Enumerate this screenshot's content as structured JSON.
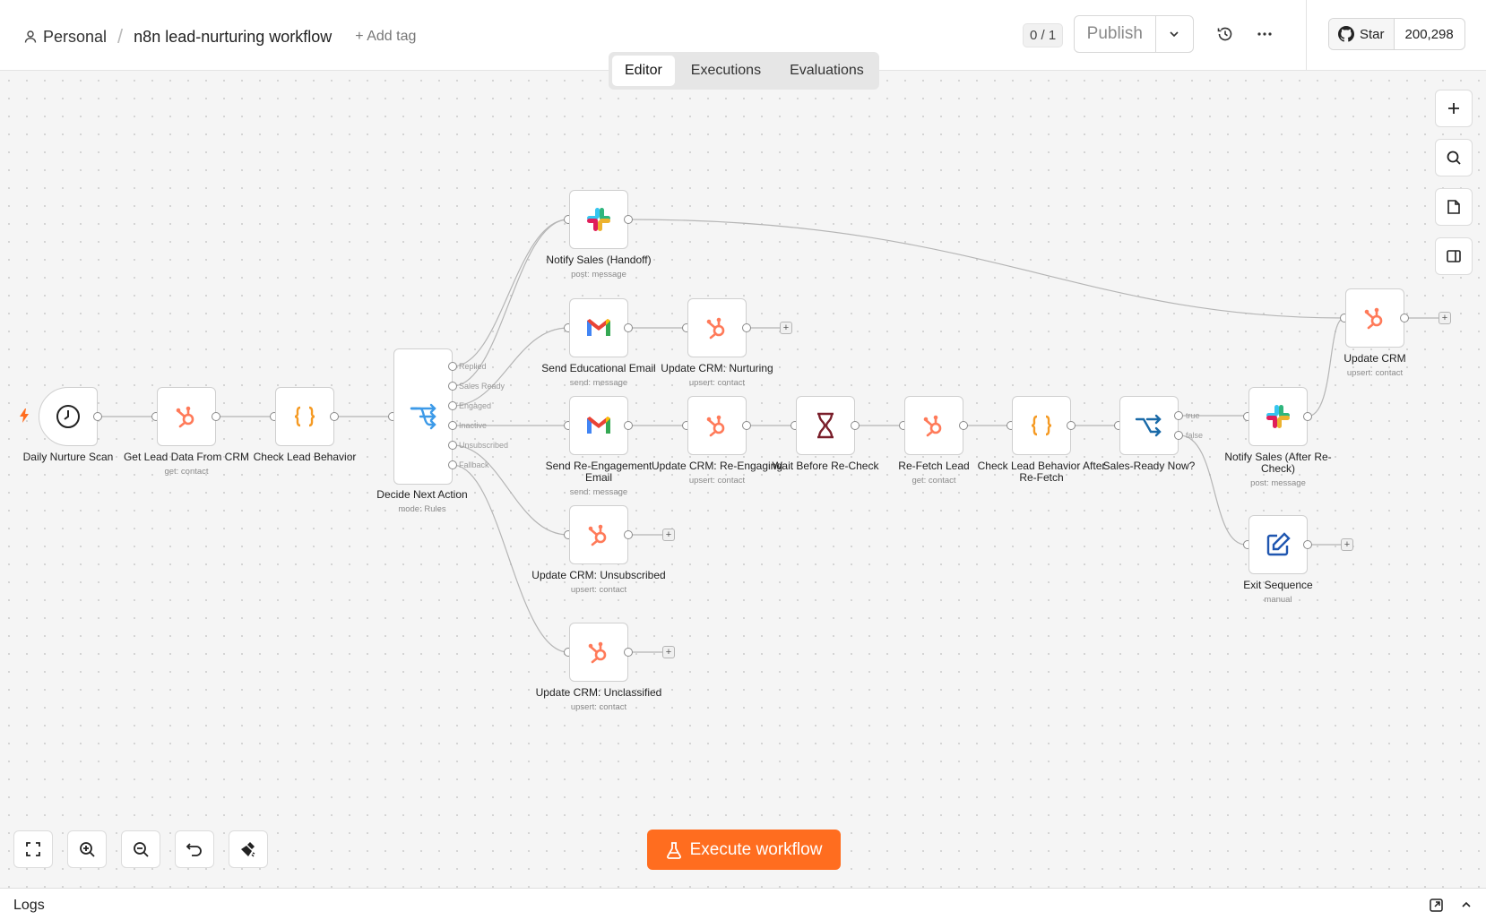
{
  "header": {
    "project": "Personal",
    "separator": "/",
    "workflow_name": "n8n lead-nurturing workflow",
    "add_tag": "+ Add tag",
    "counter": "0 / 1",
    "publish_label": "Publish",
    "github_star": "Star",
    "github_count": "200,298"
  },
  "tabs": [
    {
      "label": "Editor",
      "active": true
    },
    {
      "label": "Executions",
      "active": false
    },
    {
      "label": "Evaluations",
      "active": false
    }
  ],
  "nodes": {
    "daily_scan": {
      "label": "Daily Nurture Scan",
      "sub": "",
      "icon": "clock-icon"
    },
    "get_lead": {
      "label": "Get Lead Data From CRM",
      "sub": "get: contact",
      "icon": "hubspot-icon"
    },
    "check_behavior": {
      "label": "Check Lead Behavior",
      "sub": "",
      "icon": "code-icon"
    },
    "decide": {
      "label": "Decide Next Action",
      "sub": "mode: Rules",
      "icon": "switch-icon"
    },
    "notify_handoff": {
      "label": "Notify Sales (Handoff)",
      "sub": "post: message",
      "icon": "slack-icon"
    },
    "send_edu": {
      "label": "Send Educational Email",
      "sub": "send: message",
      "icon": "gmail-icon"
    },
    "crm_nurturing": {
      "label": "Update CRM: Nurturing",
      "sub": "upsert: contact",
      "icon": "hubspot-icon"
    },
    "send_reengage": {
      "label": "Send Re-Engagement Email",
      "sub": "send: message",
      "icon": "gmail-icon"
    },
    "crm_reengaging": {
      "label": "Update CRM: Re-Engaging",
      "sub": "upsert: contact",
      "icon": "hubspot-icon"
    },
    "wait": {
      "label": "Wait Before Re-Check",
      "sub": "",
      "icon": "hourglass-icon"
    },
    "refetch": {
      "label": "Re-Fetch Lead",
      "sub": "get: contact",
      "icon": "hubspot-icon"
    },
    "check_after": {
      "label": "Check Lead Behavior After Re-Fetch",
      "sub": "",
      "icon": "code-icon"
    },
    "sales_ready": {
      "label": "Sales-Ready Now?",
      "sub": "",
      "icon": "if-icon"
    },
    "notify_after": {
      "label": "Notify Sales (After Re-Check)",
      "sub": "post: message",
      "icon": "slack-icon"
    },
    "update_crm": {
      "label": "Update CRM",
      "sub": "upsert: contact",
      "icon": "hubspot-icon"
    },
    "exit_seq": {
      "label": "Exit Sequence",
      "sub": "manual",
      "icon": "edit-icon"
    },
    "crm_unsub": {
      "label": "Update CRM: Unsubscribed",
      "sub": "upsert: contact",
      "icon": "hubspot-icon"
    },
    "crm_unclass": {
      "label": "Update CRM: Unclassified",
      "sub": "upsert: contact",
      "icon": "hubspot-icon"
    }
  },
  "rule_outputs": [
    "Replied",
    "Sales Ready",
    "Engaged",
    "Inactive",
    "Unsubscribed",
    "Fallback"
  ],
  "if_outputs": [
    "true",
    "false"
  ],
  "add_symbol": "+",
  "execute_label": "Execute workflow",
  "logs_label": "Logs",
  "colors": {
    "accent": "#ff6d1f",
    "hubspot": "#ff7a59",
    "code": "#f59a23",
    "switch": "#3d9ae8"
  }
}
